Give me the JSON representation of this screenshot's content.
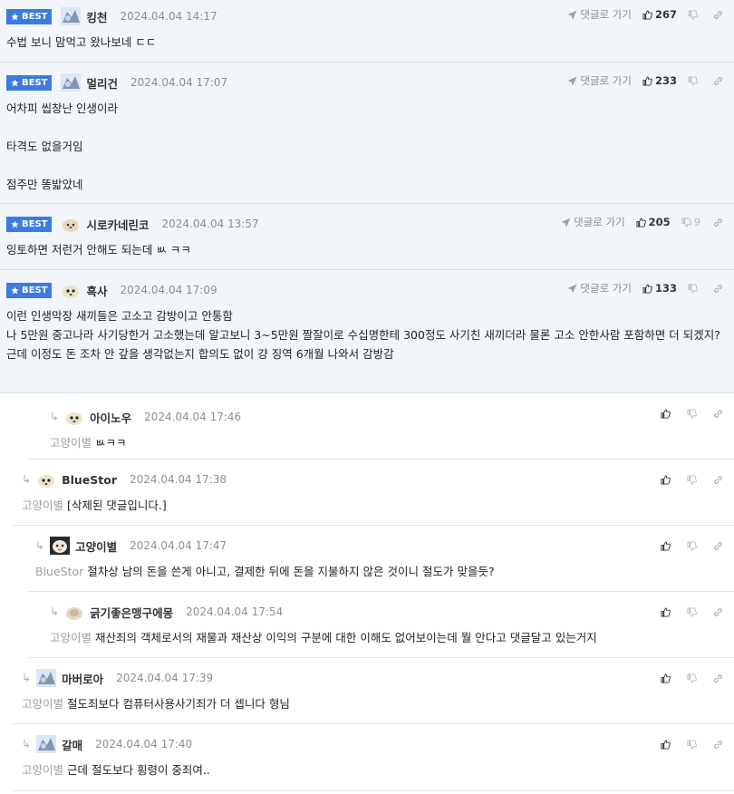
{
  "labels": {
    "best": "BEST",
    "goto_reply": "댓글로 가기"
  },
  "comments": [
    {
      "nick": "킹천",
      "date": "2024.04.04 14:17",
      "up": "267",
      "down": "",
      "text": "수법 보니 맘먹고 왔나보네 ㄷㄷ"
    },
    {
      "nick": "멀리건",
      "date": "2024.04.04 17:07",
      "up": "233",
      "down": "",
      "text": "어차피 씹창난 인생이라\n\n타격도 없을거임\n\n점주만 똥밟았네"
    },
    {
      "nick": "시로카네린코",
      "date": "2024.04.04 13:57",
      "up": "205",
      "down": "9",
      "text": "잉토하면 저런거 안해도 되는데 ㅄ ㅋㅋ"
    },
    {
      "nick": "흑사",
      "date": "2024.04.04 17:09",
      "up": "133",
      "down": "",
      "text": "이런 인생막장 새끼들은 고소고 감방이고 안통함\n나 5만원 중고나라 사기당한거 고소했는데 알고보니 3~5만원 짤잘이로 수십명한테 300정도 사기친 새끼더라 물론 고소 안한사람 포함하면 더 되겠지?\n근데 이정도 돈 조차 안 갚을 생각없는지 합의도 없이 걍 징역 6개월 나와서 감방감"
    },
    {
      "nick": "아이노우",
      "date": "2024.04.04 17:46",
      "mention": "고양이별",
      "text": "ㅄㅋㅋ"
    },
    {
      "nick": "BlueStor",
      "date": "2024.04.04 17:38",
      "mention": "고양이별",
      "text": "[삭제된 댓글입니다.]"
    },
    {
      "nick": "고양이별",
      "date": "2024.04.04 17:47",
      "mention": "BlueStor",
      "text": "절차상 남의 돈을 쓴게 아니고, 결제한 뒤에 돈을 지불하지 않은 것이니 절도가 맞을듯?"
    },
    {
      "nick": "긁기좋은맹구에몽",
      "date": "2024.04.04 17:54",
      "mention": "고양이별",
      "text": "재산죄의 객체로서의 재물과 재산상 이익의 구분에 대한 이해도 없어보이는데 뭘 안다고 댓글달고 있는거지"
    },
    {
      "nick": "마버로아",
      "date": "2024.04.04 17:39",
      "mention": "고양이별",
      "text": "절도죄보다 컴퓨터사용사기죄가 더 셉니다 형님"
    },
    {
      "nick": "갈매",
      "date": "2024.04.04 17:40",
      "mention": "고양이별",
      "text": "근데 절도보다 횡령이 중죄여.."
    }
  ]
}
